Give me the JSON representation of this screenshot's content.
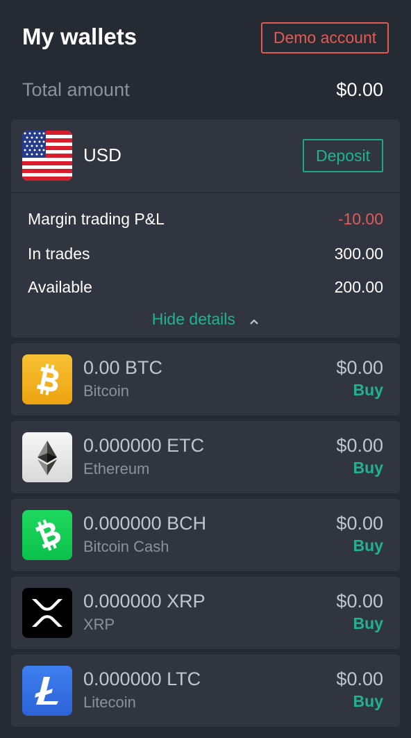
{
  "header": {
    "title": "My wallets",
    "demo_label": "Demo account"
  },
  "total": {
    "label": "Total amount",
    "value": "$0.00"
  },
  "usd_wallet": {
    "currency": "USD",
    "deposit_label": "Deposit",
    "details": [
      {
        "label": "Margin trading P&L",
        "value": "-10.00"
      },
      {
        "label": "In trades",
        "value": "300.00"
      },
      {
        "label": "Available",
        "value": "200.00"
      }
    ],
    "hide_details_label": "Hide details"
  },
  "coins": [
    {
      "amount": "0.00 BTC",
      "name": "Bitcoin",
      "usd": "$0.00",
      "buy_label": "Buy",
      "icon": "bitcoin-icon"
    },
    {
      "amount": "0.000000 ETC",
      "name": "Ethereum",
      "usd": "$0.00",
      "buy_label": "Buy",
      "icon": "ethereum-icon"
    },
    {
      "amount": "0.000000 BCH",
      "name": "Bitcoin Cash",
      "usd": "$0.00",
      "buy_label": "Buy",
      "icon": "bitcoin-cash-icon"
    },
    {
      "amount": "0.000000 XRP",
      "name": "XRP",
      "usd": "$0.00",
      "buy_label": "Buy",
      "icon": "xrp-icon"
    },
    {
      "amount": "0.000000 LTC",
      "name": "Litecoin",
      "usd": "$0.00",
      "buy_label": "Buy",
      "icon": "litecoin-icon"
    }
  ],
  "colors": {
    "background": "#262a32",
    "card": "#303540",
    "accent_green": "#20b391",
    "negative_red": "#e25b55"
  }
}
